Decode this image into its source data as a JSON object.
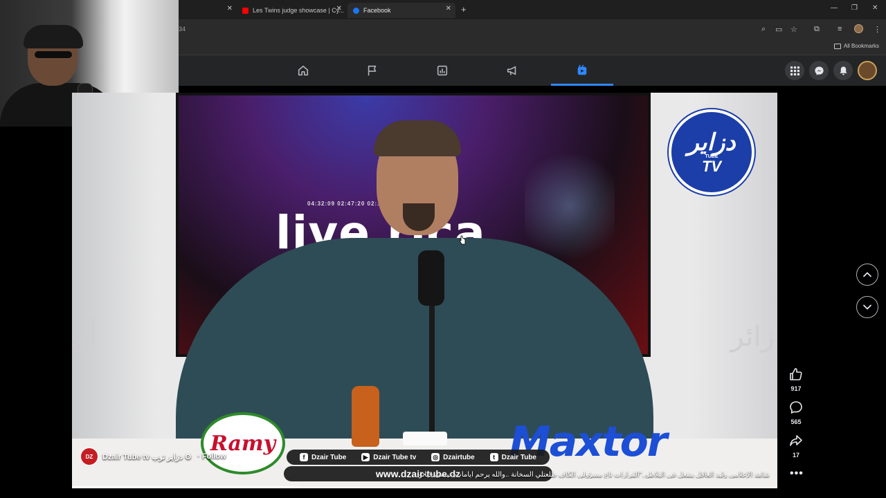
{
  "browser": {
    "tabs": [
      {
        "label": "Les Twins judge showcase | Cy..."
      },
      {
        "label": "Facebook"
      }
    ],
    "address_fragment": "34",
    "bookmarks_label": "All Bookmarks"
  },
  "video": {
    "screen_times": "04:32:09     02:47:20   02:...",
    "screen_title": "live  rica",
    "arabic_left": "أو",
    "arabic_right": "زائر",
    "logo": {
      "big": "دزاير",
      "small": "TV",
      "tiny": "TUBE"
    },
    "ramy_label": "Ramy",
    "maxtor_label": "Maxtor",
    "social": [
      {
        "icon": "f",
        "label": "Dzair Tube"
      },
      {
        "icon": "▶",
        "label": "Dzair Tube tv"
      },
      {
        "icon": "◎",
        "label": "Dzairtube"
      },
      {
        "icon": "t",
        "label": "Dzair Tube"
      }
    ],
    "url": "www.dzair-tube.dz",
    "progress": 0.32
  },
  "post": {
    "page_name": "Dzair Tube tv دزاير توب ⚙",
    "follow_label": "· Follow",
    "caption": "شاهد الإعلامي وليد العاقل ينفعل في البلاطو..\"القرارات تاع مسؤولي الكاف طلعتلي السخانة ..والله يرحم أيامات عيسى حياتو",
    "avatar_label": "DZ"
  },
  "reactions": {
    "likes": "917",
    "comments": "565",
    "shares": "17"
  },
  "colors": {
    "fb_blue": "#2d88ff",
    "header_bg": "#242526"
  }
}
